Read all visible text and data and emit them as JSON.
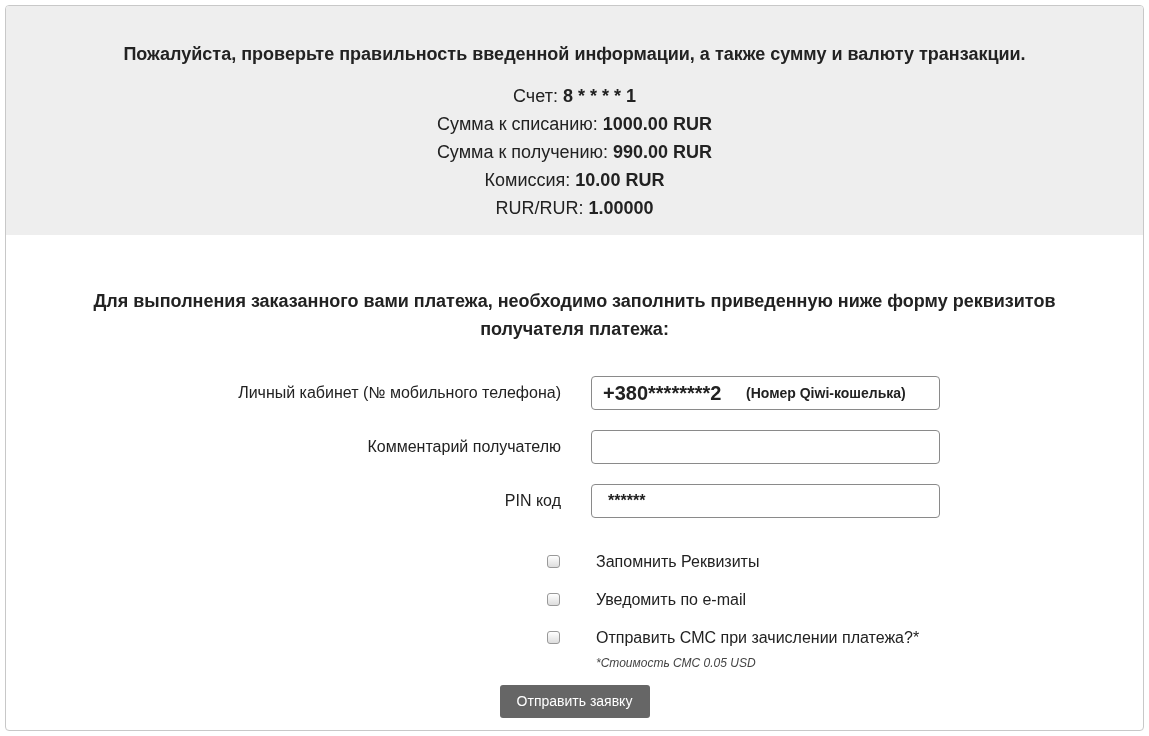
{
  "confirmation": {
    "heading": "Пожалуйста, проверьте правильность введенной информации, а также сумму и валюту транзакции.",
    "lines": [
      {
        "label": "Счет:",
        "value": "8 * * * * 1"
      },
      {
        "label": "Сумма к списанию:",
        "value": "1000.00 RUR"
      },
      {
        "label": "Сумма к получению:",
        "value": "990.00 RUR"
      },
      {
        "label": "Комиссия:",
        "value": "10.00 RUR"
      },
      {
        "label": "RUR/RUR:",
        "value": "1.00000"
      }
    ]
  },
  "form": {
    "heading": "Для выполнения заказанного вами платежа, необходимо заполнить приведенную ниже форму реквизитов получателя платежа:",
    "fields": [
      {
        "label": "Личный кабинет (№ мобильного телефона)",
        "value": "+380********2",
        "hint": "(Номер Qiwi-кошелька)",
        "kind": "phone"
      },
      {
        "label": "Комментарий получателю",
        "kind": "text"
      },
      {
        "label": "PIN код",
        "value": "******",
        "kind": "pin"
      }
    ],
    "checkboxes": [
      {
        "label": "Запомнить Реквизиты",
        "checked": false
      },
      {
        "label": "Уведомить по e-mail",
        "checked": false
      },
      {
        "label": "Отправить СМС при зачислении платежа?*",
        "checked": false,
        "note": "*Стоимость СМС 0.05 USD"
      }
    ],
    "submit": "Отправить заявку"
  }
}
